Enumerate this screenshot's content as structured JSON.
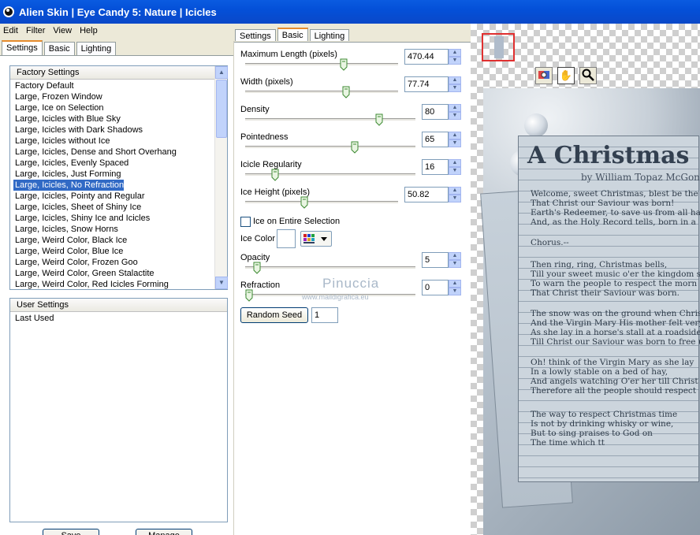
{
  "title": "Alien Skin | Eye Candy 5: Nature | Icicles",
  "menu": [
    "Edit",
    "Filter",
    "View",
    "Help"
  ],
  "left_tabs": [
    "Settings",
    "Basic",
    "Lighting"
  ],
  "factory": {
    "header": "Factory Settings",
    "items": [
      "Factory Default",
      "Large, Frozen Window",
      "Large, Ice on Selection",
      "Large, Icicles with Blue Sky",
      "Large, Icicles with Dark Shadows",
      "Large, Icicles without Ice",
      "Large, Icicles, Dense and Short Overhang",
      "Large, Icicles, Evenly Spaced",
      "Large, Icicles, Just Forming",
      "Large, Icicles, No Refraction",
      "Large, Icicles, Pointy and Regular",
      "Large, Icicles, Sheet of Shiny Ice",
      "Large, Icicles, Shiny Ice and Icicles",
      "Large, Icicles, Snow Horns",
      "Large, Weird Color, Black Ice",
      "Large, Weird Color, Blue Ice",
      "Large, Weird Color, Frozen Goo",
      "Large, Weird Color, Green Stalactite",
      "Large, Weird Color, Red Icicles Forming"
    ],
    "selected_index": 9
  },
  "user": {
    "header": "User Settings",
    "items": [
      "Last Used"
    ]
  },
  "bottom_buttons": [
    "Save",
    "Manage"
  ],
  "mid_tabs": [
    "Settings",
    "Basic",
    "Lighting"
  ],
  "params": {
    "max_length": {
      "label": "Maximum Length (pixels)",
      "value": "470.44",
      "level": 0.65
    },
    "width": {
      "label": "Width (pixels)",
      "value": "77.74",
      "level": 0.67
    },
    "density": {
      "label": "Density",
      "value": "80",
      "level": 0.8
    },
    "pointedness": {
      "label": "Pointedness",
      "value": "65",
      "level": 0.65
    },
    "regularity": {
      "label": "Icicle Regularity",
      "value": "16",
      "level": 0.16
    },
    "ice_height": {
      "label": "Ice Height (pixels)",
      "value": "50.82",
      "level": 0.38
    },
    "opacity": {
      "label": "Opacity",
      "value": "5",
      "level": 0.05
    },
    "refraction": {
      "label": "Refraction",
      "value": "0",
      "level": 0.0
    }
  },
  "ice_entire": {
    "label": "Ice on Entire Selection",
    "checked": false
  },
  "ice_color": {
    "label": "Ice Color",
    "value": "#ffffff"
  },
  "random_seed": {
    "button": "Random Seed",
    "value": "1"
  },
  "watermark": {
    "name": "Pinuccia",
    "site": "www.maildigrafica.eu"
  },
  "preview": {
    "title": "A Christmas",
    "byline": "by William Topaz McGon",
    "lines": [
      "Welcome, sweet Christmas, blest be the",
      "That Christ our Saviour was born!",
      "Earth's Redeemer, to save us from all ha",
      "And, as the Holy Record tells, born in a",
      "Chorus.--",
      "Then ring, ring, Christmas bells,",
      "Till your sweet music o'er the kingdom su",
      "To warn the people to respect the morn",
      "That Christ their Saviour was born.",
      "The snow was on the ground when Christ",
      "And the Virgin Mary His mother felt very",
      "As she lay in a horse's stall at a roadside in",
      "Till Christ our Saviour was born to free u",
      "Oh! think of the Virgin Mary as she lay",
      "In a lowly stable on a bed of hay,",
      "And angels watching O'er her till Christ w",
      "Therefore all the people should respect",
      "The way to respect Christmas time",
      "Is not by drinking whisky or wine,",
      "But to sing praises to God on",
      "The time which tt "
    ]
  }
}
